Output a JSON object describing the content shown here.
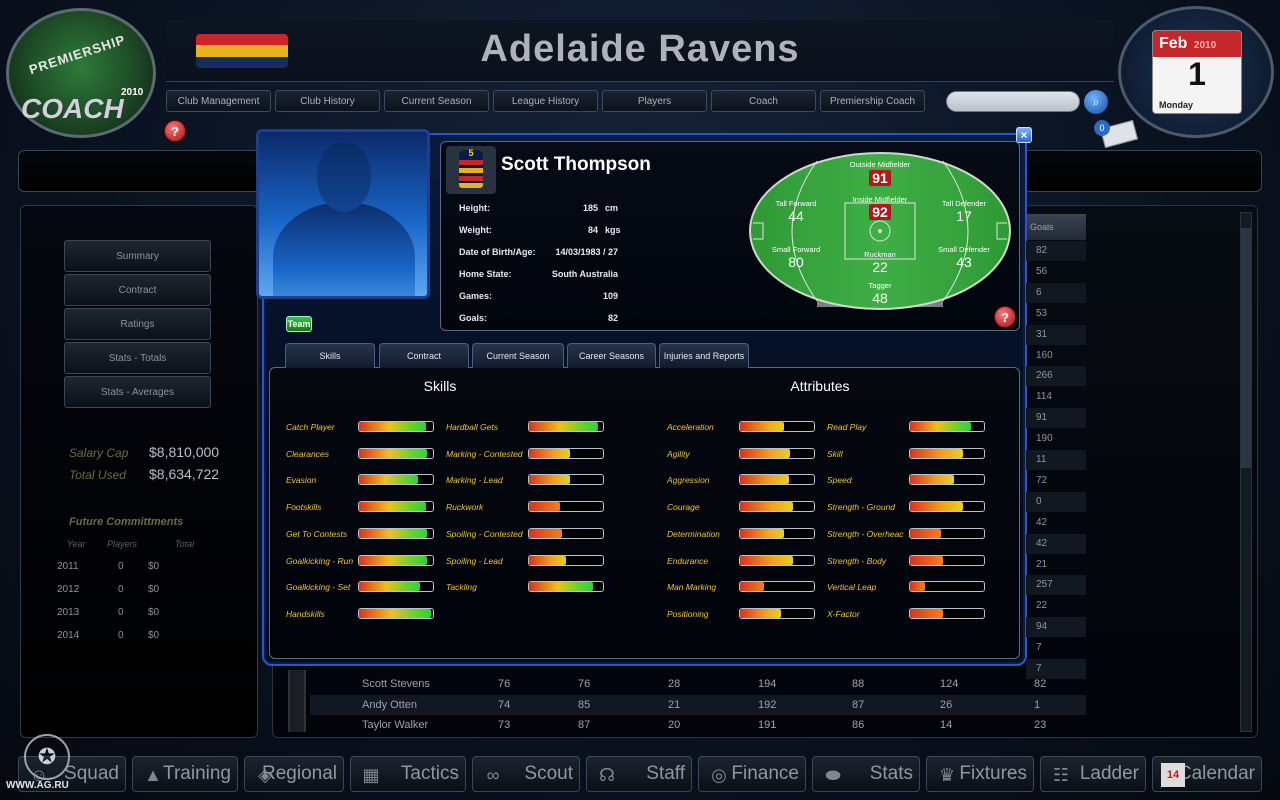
{
  "logo": {
    "line1": "PREMIERSHIP",
    "line2": "COACH",
    "year": "2010"
  },
  "header": {
    "club_name": "Adelaide Ravens",
    "flag_colors": [
      "#c8262a",
      "#e8b21d",
      "#1a2b5f"
    ]
  },
  "topnav": [
    {
      "label": "Club Management",
      "w": 105
    },
    {
      "label": "Club History",
      "w": 105
    },
    {
      "label": "Current Season",
      "w": 105
    },
    {
      "label": "League History",
      "w": 105
    },
    {
      "label": "Players",
      "w": 105
    },
    {
      "label": "Coach",
      "w": 105
    },
    {
      "label": "Premiership Coach",
      "w": 105
    }
  ],
  "calendar": {
    "month": "Feb",
    "year": "2010",
    "day": "1",
    "weekday": "Monday"
  },
  "mail_count": "0",
  "sidebar": {
    "buttons": [
      "Summary",
      "Contract",
      "Ratings",
      "Stats - Totals",
      "Stats - Averages"
    ],
    "salary_cap_label": "Salary Cap",
    "salary_cap_value": "$8,810,000",
    "total_used_label": "Total Used",
    "total_used_value": "$8,634,722",
    "future_title": "Future Committments",
    "future_headers": [
      "Year",
      "Players",
      "Total"
    ],
    "future_rows": [
      [
        "2011",
        "0",
        "$0"
      ],
      [
        "2012",
        "0",
        "$0"
      ],
      [
        "2013",
        "0",
        "$0"
      ],
      [
        "2014",
        "0",
        "$0"
      ]
    ]
  },
  "table": {
    "goals_header": "Goals",
    "goals": [
      "82",
      "56",
      "6",
      "53",
      "31",
      "160",
      "266",
      "114",
      "91",
      "190",
      "11",
      "72",
      "0",
      "42",
      "42",
      "21",
      "257",
      "22",
      "94",
      "7",
      "7"
    ],
    "rows": [
      [
        "Scott Stevens",
        "76",
        "76",
        "28",
        "194",
        "88",
        "124",
        "82"
      ],
      [
        "Andy Otten",
        "74",
        "85",
        "21",
        "192",
        "87",
        "26",
        "1"
      ],
      [
        "Taylor Walker",
        "73",
        "87",
        "20",
        "191",
        "86",
        "14",
        "23"
      ]
    ]
  },
  "bottomnav": [
    {
      "label": "Squad",
      "icon": "person-icon",
      "glyph": "☺"
    },
    {
      "label": "Training",
      "icon": "cone-icon",
      "glyph": "▲"
    },
    {
      "label": "Regional",
      "icon": "map-icon",
      "glyph": "◈"
    },
    {
      "label": "Tactics",
      "icon": "clipboard-icon",
      "glyph": "▦"
    },
    {
      "label": "Scout",
      "icon": "binoculars-icon",
      "glyph": "∞"
    },
    {
      "label": "Staff",
      "icon": "headset-icon",
      "glyph": "☊"
    },
    {
      "label": "Finance",
      "icon": "coins-icon",
      "glyph": "◎"
    },
    {
      "label": "Stats",
      "icon": "football-icon",
      "glyph": "⬬"
    },
    {
      "label": "Fixtures",
      "icon": "trophy-icon",
      "glyph": "♛"
    },
    {
      "label": "Ladder",
      "icon": "ladder-icon",
      "glyph": "☷"
    },
    {
      "label": "Calendar",
      "icon": "calendar-icon",
      "glyph": "14"
    }
  ],
  "watermark": "WWW.AG.RU",
  "player": {
    "guernsey_number": "5",
    "name": "Scott Thompson",
    "team_button": "Team",
    "info": [
      {
        "label": "Height:",
        "value": "185",
        "unit": "cm"
      },
      {
        "label": "Weight:",
        "value": "84",
        "unit": "kgs"
      },
      {
        "label": "Date of Birth/Age:",
        "value": "14/03/1983  /  27",
        "unit": ""
      },
      {
        "label": "Home State:",
        "value": "South Australia",
        "unit": ""
      },
      {
        "label": "Games:",
        "value": "109",
        "unit": ""
      },
      {
        "label": "Goals:",
        "value": "82",
        "unit": ""
      }
    ],
    "positions": [
      {
        "name": "Outside Midfielder",
        "value": "91",
        "highlight": true
      },
      {
        "name": "Tall Forward",
        "value": "44",
        "highlight": false
      },
      {
        "name": "Inside Midfielder",
        "value": "92",
        "highlight": true
      },
      {
        "name": "Tall Defender",
        "value": "17",
        "highlight": false
      },
      {
        "name": "Small Forward",
        "value": "80",
        "highlight": false
      },
      {
        "name": "Ruckman",
        "value": "22",
        "highlight": false
      },
      {
        "name": "Small Defender",
        "value": "43",
        "highlight": false
      },
      {
        "name": "Tagger",
        "value": "48",
        "highlight": false
      }
    ],
    "tabs": [
      "Skills",
      "Contract",
      "Current Season",
      "Career Seasons",
      "Injuries and Reports"
    ],
    "skills_title": "Skills",
    "attributes_title": "Attributes",
    "skills_col1": [
      {
        "name": "Catch Player",
        "level": 0.9
      },
      {
        "name": "Clearances",
        "level": 0.92
      },
      {
        "name": "Evasion",
        "level": 0.8
      },
      {
        "name": "Footskills",
        "level": 0.9
      },
      {
        "name": "Get To Contests",
        "level": 0.92
      },
      {
        "name": "Goalkicking - Run",
        "level": 0.92
      },
      {
        "name": "Goalkicking - Set",
        "level": 0.82
      },
      {
        "name": "Handskills",
        "level": 0.97
      }
    ],
    "skills_col2": [
      {
        "name": "Hardball Gets",
        "level": 0.93
      },
      {
        "name": "Marking - Contested",
        "level": 0.55
      },
      {
        "name": "Marking - Lead",
        "level": 0.55
      },
      {
        "name": "Ruckwork",
        "level": 0.42
      },
      {
        "name": "Spoiling - Contested",
        "level": 0.45
      },
      {
        "name": "Spoiling - Lead",
        "level": 0.5
      },
      {
        "name": "Tackling",
        "level": 0.87
      }
    ],
    "attributes_col1": [
      {
        "name": "Acceleration",
        "level": 0.6
      },
      {
        "name": "Agility",
        "level": 0.68
      },
      {
        "name": "Aggression",
        "level": 0.66
      },
      {
        "name": "Courage",
        "level": 0.72
      },
      {
        "name": "Determination",
        "level": 0.6
      },
      {
        "name": "Endurance",
        "level": 0.72
      },
      {
        "name": "Man Marking",
        "level": 0.32
      },
      {
        "name": "Positioning",
        "level": 0.55
      }
    ],
    "attributes_col2": [
      {
        "name": "Read Play",
        "level": 0.82
      },
      {
        "name": "Skill",
        "level": 0.72
      },
      {
        "name": "Speed",
        "level": 0.6
      },
      {
        "name": "Strength - Ground",
        "level": 0.72
      },
      {
        "name": "Strength - Overheac",
        "level": 0.42
      },
      {
        "name": "Strength - Body",
        "level": 0.45
      },
      {
        "name": "Vertical Leap",
        "level": 0.2
      },
      {
        "name": "X-Factor",
        "level": 0.45
      }
    ]
  }
}
